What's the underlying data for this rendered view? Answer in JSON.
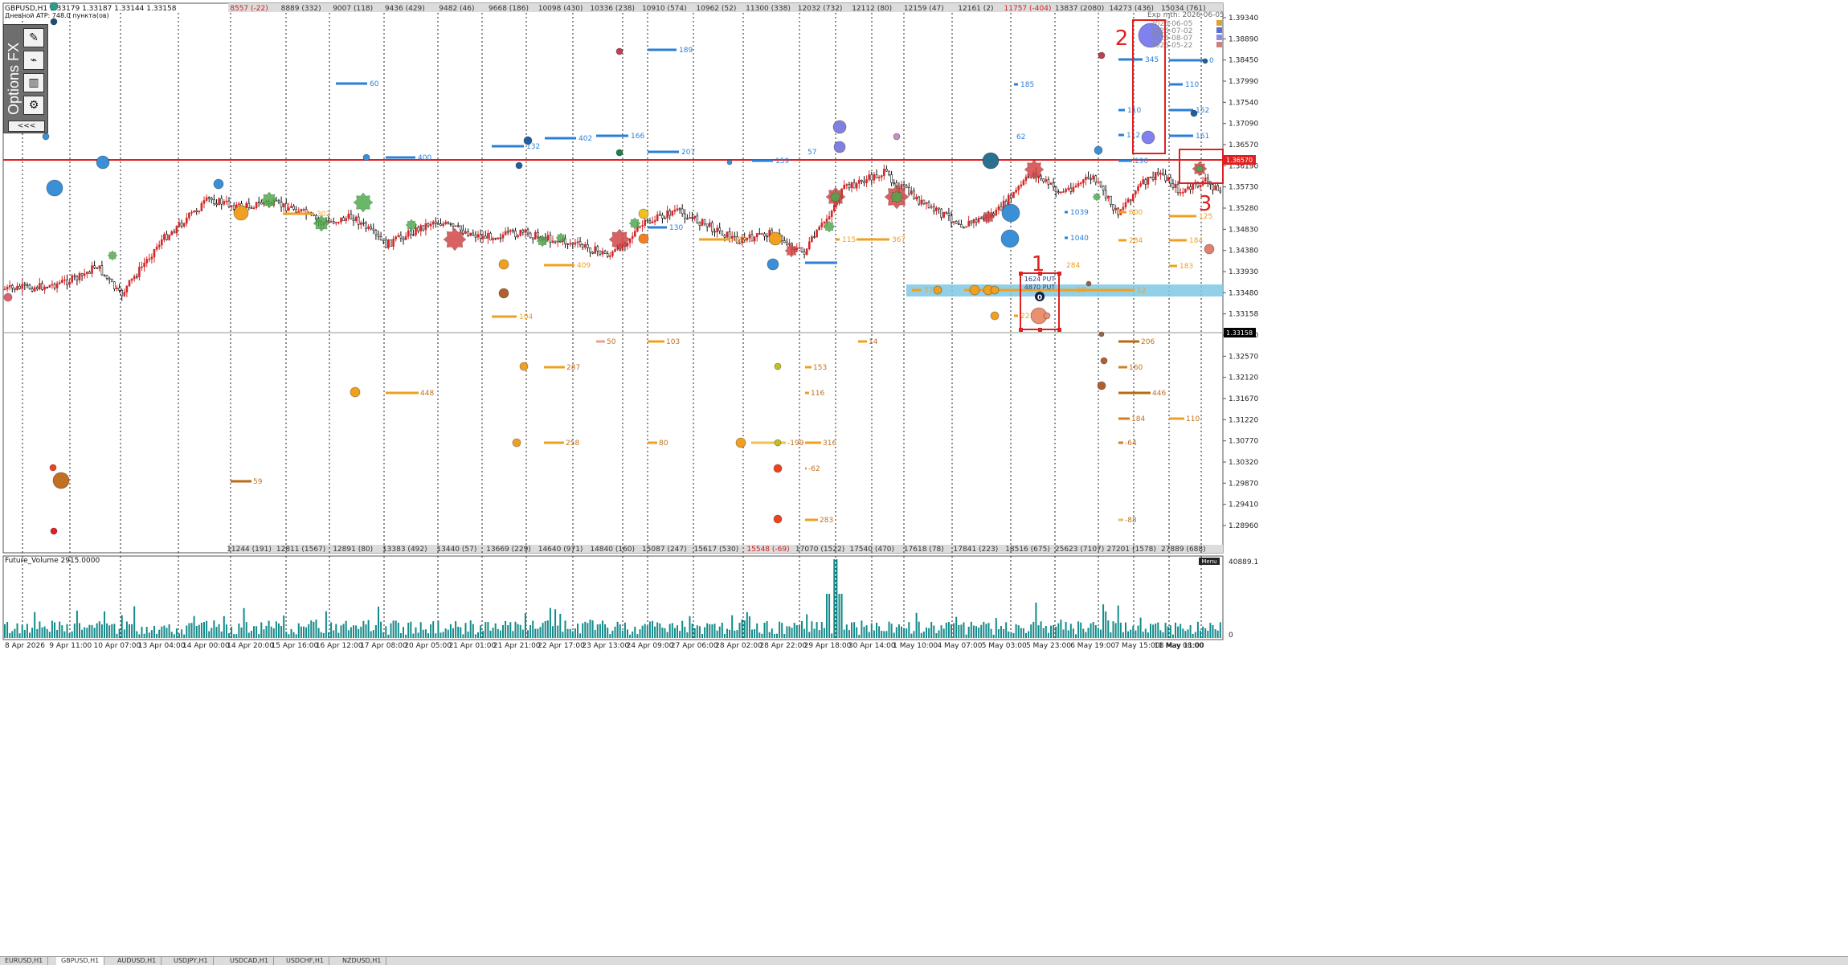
{
  "header": {
    "symbol_line": "GBPUSD,H1  1.33179 1.33187 1.33144 1.33158",
    "atr_line": "Дневной ATP: 748.0 пункта(ов)"
  },
  "toolbox": {
    "label": "Options FX",
    "back_label": "<<<"
  },
  "top_strikes": [
    {
      "text": "8557 (-22)",
      "neg": true
    },
    {
      "text": "8889 (332)",
      "neg": false
    },
    {
      "text": "9007 (118)",
      "neg": false
    },
    {
      "text": "9436 (429)",
      "neg": false
    },
    {
      "text": "9482 (46)",
      "neg": false
    },
    {
      "text": "9668 (186)",
      "neg": false
    },
    {
      "text": "10098 (430)",
      "neg": false
    },
    {
      "text": "10336 (238)",
      "neg": false
    },
    {
      "text": "10910 (574)",
      "neg": false
    },
    {
      "text": "10962 (52)",
      "neg": false
    },
    {
      "text": "11300 (338)",
      "neg": false
    },
    {
      "text": "12032 (732)",
      "neg": false
    },
    {
      "text": "12112 (80)",
      "neg": false
    },
    {
      "text": "12159 (47)",
      "neg": false
    },
    {
      "text": "12161 (2)",
      "neg": false
    },
    {
      "text": "11757 (-404)",
      "neg": true
    },
    {
      "text": "13837 (2080)",
      "neg": false
    },
    {
      "text": "14273 (436)",
      "neg": false
    },
    {
      "text": "15034 (761)",
      "neg": false
    }
  ],
  "bottom_strikes": [
    {
      "text": "11244 (191)",
      "neg": false
    },
    {
      "text": "12811 (1567)",
      "neg": false
    },
    {
      "text": "12891 (80)",
      "neg": false
    },
    {
      "text": "13383 (492)",
      "neg": false
    },
    {
      "text": "13440 (57)",
      "neg": false
    },
    {
      "text": "13669 (229)",
      "neg": false
    },
    {
      "text": "14640 (971)",
      "neg": false
    },
    {
      "text": "14840 (160)",
      "neg": false
    },
    {
      "text": "15087 (247)",
      "neg": false
    },
    {
      "text": "15617 (530)",
      "neg": false
    },
    {
      "text": "15548 (-69)",
      "neg": true
    },
    {
      "text": "17070 (1522)",
      "neg": false
    },
    {
      "text": "17540 (470)",
      "neg": false
    },
    {
      "text": "17618 (78)",
      "neg": false
    },
    {
      "text": "17841 (223)",
      "neg": false
    },
    {
      "text": "18516 (675)",
      "neg": false
    },
    {
      "text": "25623 (7107)",
      "neg": false
    },
    {
      "text": "27201 (1578)",
      "neg": false
    },
    {
      "text": "27889 (688)",
      "neg": false
    }
  ],
  "price_axis": [
    "1.39340",
    "1.38890",
    "1.38450",
    "1.37990",
    "1.37540",
    "1.37090",
    "1.36570",
    "1.36190",
    "1.35730",
    "1.35280",
    "1.34830",
    "1.34380",
    "1.33930",
    "1.33480",
    "1.33158",
    "1.33030",
    "1.32570",
    "1.32120",
    "1.31670",
    "1.31220",
    "1.30770",
    "1.30320",
    "1.29870",
    "1.29410",
    "1.28960"
  ],
  "price_badges": {
    "red_line": "1.36570",
    "current": "1.33158"
  },
  "time_axis": [
    "8 Apr 2026",
    "9 Apr 11:00",
    "10 Apr 07:00",
    "13 Apr 04:00",
    "14 Apr 00:00",
    "14 Apr 20:00",
    "15 Apr 16:00",
    "16 Apr 12:00",
    "17 Apr 08:00",
    "20 Apr 05:00",
    "21 Apr 01:00",
    "21 Apr 21:00",
    "22 Apr 17:00",
    "23 Apr 13:00",
    "24 Apr 09:00",
    "27 Apr 06:00",
    "28 Apr 02:00",
    "28 Apr 22:00",
    "29 Apr 18:00",
    "30 Apr 14:00",
    "1 May 10:00",
    "4 May 07:00",
    "5 May 03:00",
    "5 May 23:00",
    "6 May 19:00",
    "7 May 15:00",
    "8 May 11:00",
    "11 May 08:00"
  ],
  "expiry_legend": {
    "title": "Exp mth: 2026-06-05",
    "items": [
      {
        "text": "2026-06-05",
        "color": "#e0a030"
      },
      {
        "text": "2026-07-02",
        "color": "#5b6fd0"
      },
      {
        "text": "2026-08-07",
        "color": "#8c8ce8"
      },
      {
        "text": "2026-05-22",
        "color": "#d08080"
      }
    ]
  },
  "level_labels": {
    "blue": [
      "60",
      "400",
      "132",
      "402",
      "166",
      "189",
      "207",
      "57",
      "159",
      "185",
      "62",
      "345",
      "110",
      "112",
      "190",
      "0",
      "110",
      "152",
      "161",
      "130",
      "1039",
      "1040"
    ],
    "orange": [
      "302",
      "428",
      "409",
      "104",
      "367",
      "600",
      "284",
      "125",
      "184",
      "183",
      "115",
      "77",
      "12",
      "97",
      "221",
      "1468"
    ],
    "lower": [
      "50",
      "103",
      "14",
      "287",
      "448",
      "153",
      "116",
      "258",
      "80",
      "-199",
      "316",
      "-62",
      "59",
      "283",
      "206",
      "160",
      "446",
      "184",
      "110",
      "-64",
      "-88"
    ]
  },
  "annotations": {
    "box1": {
      "number": "1",
      "line1": "1624  PUT",
      "line2": "4870  PUT",
      "zero": "0"
    },
    "box2": {
      "number": "2"
    },
    "box3": {
      "number": "3"
    }
  },
  "volume_panel": {
    "label": "Future_Volume 2915.0000",
    "axis_top": "40889.1",
    "axis_bottom": "0",
    "menu_label": "Menu"
  },
  "bottom_tabs": [
    "EURUSD,H1",
    "GBPUSD,H1",
    "AUDUSD,H1",
    "USDJPY,H1",
    "USDCAD,H1",
    "USDCHF,H1",
    "NZDUSD,H1"
  ],
  "colors": {
    "candle_up": "#228b22",
    "candle_down": "#d62728",
    "red_line": "#e02020",
    "blue_level": "#2a7fd6",
    "orange_level": "#f0a020",
    "band": "#7ec8e3",
    "volume": "#148a8a",
    "annotation": "#e02020"
  }
}
